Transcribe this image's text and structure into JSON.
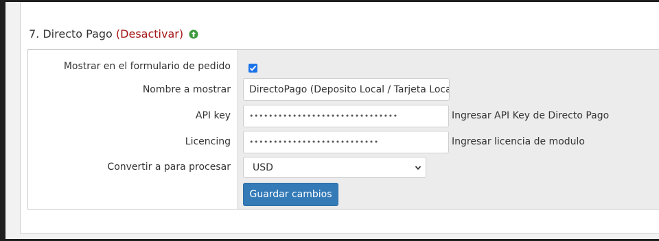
{
  "section": {
    "title": "7. Directo Pago",
    "deactivate_link": "(Desactivar)",
    "up_icon": "arrow-up-circle-icon"
  },
  "form": {
    "show_on_order_form": {
      "label": "Mostrar en el formulario de pedido",
      "checked": true
    },
    "display_name": {
      "label": "Nombre a mostrar",
      "value": "DirectoPago (Deposito Local / Tarjeta Local)"
    },
    "api_key": {
      "label": "API key",
      "value": "•••••••••••••••••••••••••••••••",
      "help": "Ingresar API Key de Directo Pago"
    },
    "licencing": {
      "label": "Licencing",
      "value": "•••••••••••••••••••••••••••",
      "help": "Ingresar licencia de modulo"
    },
    "convert_currency": {
      "label": "Convertir a para procesar",
      "selected": "USD"
    },
    "save_button": "Guardar cambios"
  },
  "colors": {
    "deactivate": "#a31515",
    "primary_button": "#337ab7",
    "up_icon": "#3c9a3c",
    "checkbox": "#1a73e8"
  }
}
